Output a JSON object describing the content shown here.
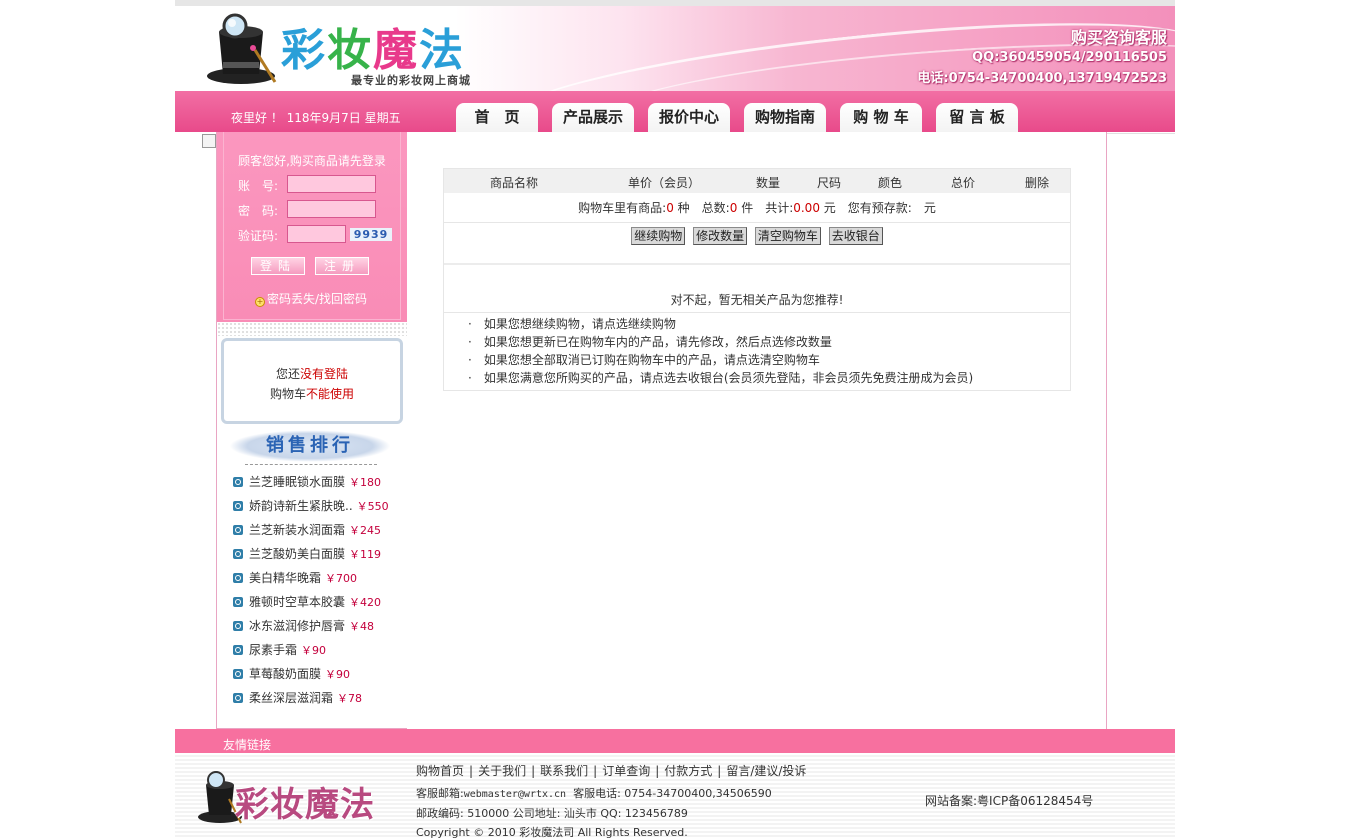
{
  "header": {
    "logo_text": [
      "彩",
      "妆",
      "魔",
      "法"
    ],
    "logo_sub": "最专业的彩妆网上商城",
    "contact_title": "购买咨询客服",
    "contact_qq": "QQ:360459054/290116505",
    "contact_phone": "电话:0754-34700400,13719472523",
    "colors": {
      "nav": "#e84a8a",
      "footer_bar": "#f7709f",
      "accent_red": "#cc0000"
    }
  },
  "nav": {
    "greeting": "夜里好 ！ 118年9月7日 星期五",
    "tabs": [
      "首　页",
      "产品展示",
      "报价中心",
      "购物指南",
      "购 物 车",
      "留 言 板"
    ]
  },
  "login": {
    "greet": "顾客您好,购买商品请先登录",
    "account_label": "账　号:",
    "password_label": "密　码:",
    "captcha_label": "验证码:",
    "captcha_value": "9939",
    "login_button": "登陆",
    "register_button": "注册",
    "forgot": "密码丢失/找回密码"
  },
  "notice": {
    "line1_prefix": "您还",
    "line1_red": "没有登陆",
    "line2_prefix": "购物车",
    "line2_red": "不能使用"
  },
  "ranking": {
    "title": "销售排行",
    "items": [
      {
        "name": "兰芝睡眠锁水面膜",
        "price": "￥180"
      },
      {
        "name": "娇韵诗新生紧肤晚..",
        "price": "￥550"
      },
      {
        "name": "兰芝新装水润面霜",
        "price": "￥245"
      },
      {
        "name": "兰芝酸奶美白面膜",
        "price": "￥119"
      },
      {
        "name": "美白精华晚霜",
        "price": "￥700"
      },
      {
        "name": "雅顿时空草本胶囊",
        "price": "￥420"
      },
      {
        "name": "冰东滋润修护唇膏",
        "price": "￥48"
      },
      {
        "name": "尿素手霜",
        "price": "￥90"
      },
      {
        "name": "草莓酸奶面膜",
        "price": "￥90"
      },
      {
        "name": "柔丝深层滋润霜",
        "price": "￥78"
      }
    ]
  },
  "cart": {
    "columns": [
      "商品名称",
      "单价（会员）",
      "数量",
      "尺码",
      "颜色",
      "总价",
      "删除"
    ],
    "summary": {
      "text1": "购物车里有商品:",
      "kinds": "0",
      "text2": "种　总数:",
      "count": "0",
      "text3": "件　共计:",
      "total": "0.00",
      "text4": "元　您有预存款:　元"
    },
    "buttons": [
      "继续购物",
      "修改数量",
      "清空购物车",
      "去收银台"
    ],
    "sorry": "对不起，暂无相关产品为您推荐!",
    "tips": [
      "·　如果您想继续购物，请点选继续购物",
      "·　如果您想更新已在购物车内的产品，请先修改，然后点选修改数量",
      "·　如果您想全部取消已订购在购物车中的产品，请点选清空购物车",
      "·　如果您满意您所购买的产品，请点选去收银台(会员须先登陆，非会员须先免费注册成为会员)"
    ]
  },
  "footer": {
    "friend_links": "友情链接",
    "logo_text": "彩妆魔法",
    "links": [
      "购物首页",
      "关于我们",
      "联系我们",
      "订单查询",
      "付款方式",
      "留言/建议/投诉"
    ],
    "email_label": "客服邮箱:",
    "email": "webmaster@wrtx.cn",
    "phone": "客服电话: 0754-34700400,34506590",
    "address": "邮政编码: 510000 公司地址: 汕头市 QQ: 123456789",
    "copyright": "Copyright © 2010 彩妆魔法司 All Rights Reserved.",
    "icp": "网站备案:粤ICP备06128454号"
  }
}
